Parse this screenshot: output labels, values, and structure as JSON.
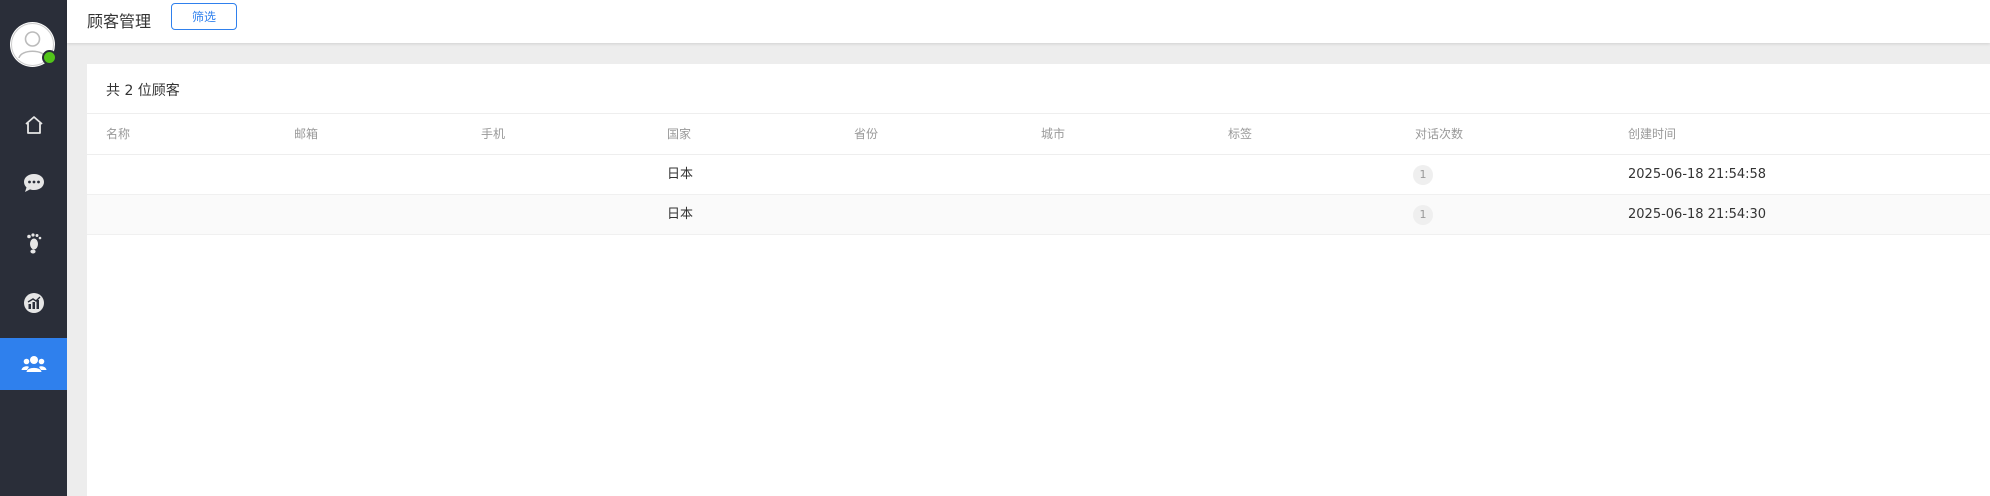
{
  "header": {
    "title": "顾客管理",
    "filter_label": "筛选"
  },
  "sidebar": {
    "items": [
      {
        "icon": "home-icon",
        "active": false
      },
      {
        "icon": "chat-icon",
        "active": false
      },
      {
        "icon": "footprint-icon",
        "active": false
      },
      {
        "icon": "analytics-icon",
        "active": false
      },
      {
        "icon": "customers-icon",
        "active": true
      }
    ],
    "online_status_color": "#52c41a"
  },
  "main": {
    "summary": "共 2 位顾客",
    "columns": [
      "名称",
      "邮箱",
      "手机",
      "国家",
      "省份",
      "城市",
      "标签",
      "对话次数",
      "创建时间"
    ],
    "rows": [
      {
        "name": "",
        "email": "",
        "phone": "",
        "country": "日本",
        "province": "",
        "city": "",
        "tags": "",
        "conversations": "1",
        "created_at": "2025-06-18 21:54:58"
      },
      {
        "name": "",
        "email": "",
        "phone": "",
        "country": "日本",
        "province": "",
        "city": "",
        "tags": "",
        "conversations": "1",
        "created_at": "2025-06-18 21:54:30"
      }
    ]
  },
  "colors": {
    "accent": "#2f80ed",
    "sidebar_bg": "#2a2e39"
  }
}
